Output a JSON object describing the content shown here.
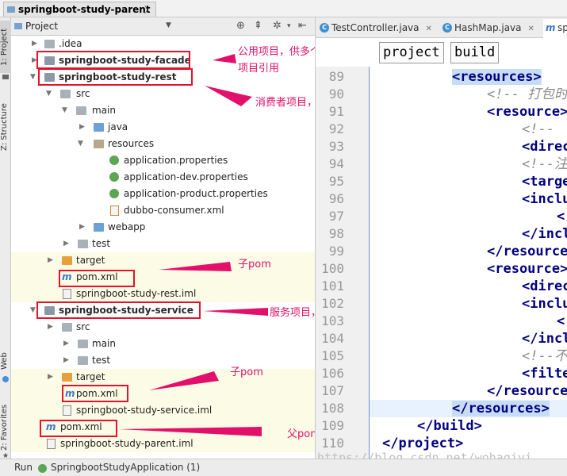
{
  "titlebar": {
    "project_name": "springboot-study-parent"
  },
  "leftbar": {
    "tabs": [
      "1: Project",
      "Z: Structure",
      "Web",
      "2: Favorites"
    ]
  },
  "project_panel": {
    "title": "Project"
  },
  "tree": [
    {
      "label": ".idea"
    },
    {
      "label": "springboot-study-facade"
    },
    {
      "label": "springboot-study-rest"
    },
    {
      "label": "src"
    },
    {
      "label": "main"
    },
    {
      "label": "java"
    },
    {
      "label": "resources"
    },
    {
      "label": "application.properties"
    },
    {
      "label": "application-dev.properties"
    },
    {
      "label": "application-product.properties"
    },
    {
      "label": "dubbo-consumer.xml"
    },
    {
      "label": "webapp"
    },
    {
      "label": "test"
    },
    {
      "label": "target"
    },
    {
      "label": "pom.xml"
    },
    {
      "label": "springboot-study-rest.iml"
    },
    {
      "label": "springboot-study-service"
    },
    {
      "label": "src"
    },
    {
      "label": "main"
    },
    {
      "label": "test"
    },
    {
      "label": "target"
    },
    {
      "label": "pom.xml"
    },
    {
      "label": "springboot-study-service.iml"
    },
    {
      "label": "pom.xml"
    },
    {
      "label": "springboot-study-parent.iml"
    }
  ],
  "annotations": {
    "facade_line1": "公用项目，供多个",
    "facade_line2": "项目引用",
    "rest": "消费者项目，本项目是一个war包",
    "rest_pom": "子pom",
    "service": "服务项目，本项目是一个jar包",
    "service_pom": "子pom",
    "parent_pom": "父pom"
  },
  "editor_tabs": [
    {
      "label": "TestController.java",
      "icon": "C"
    },
    {
      "label": "HashMap.java",
      "icon": "C"
    },
    {
      "label": "sp",
      "icon": "m"
    }
  ],
  "breadcrumbs": [
    "project",
    "build"
  ],
  "line_numbers": [
    "89",
    "90",
    "91",
    "92",
    "93",
    "94",
    "95",
    "96",
    "97",
    "98",
    "99",
    "100",
    "101",
    "102",
    "103",
    "104",
    "105",
    "106",
    "107",
    "108",
    "109",
    "110"
  ],
  "code_lines": [
    "<resources>",
    "<!-- 打包时",
    "<resource>",
    "<!--",
    "<direc",
    "<!--注",
    "<targe",
    "<inclu",
    "<",
    "</incl",
    "</resource",
    "<resource>",
    "<direc",
    "<inclu",
    "<",
    "</incl",
    "<!--不",
    "<filte",
    "</resource",
    "</resources>",
    "</build>",
    "</project>"
  ],
  "watermark": "https://blog.csdn.net/wohaqiyi",
  "statusbar": {
    "run_label": "Run",
    "app_label": "SpringbootStudyApplication (1)"
  }
}
